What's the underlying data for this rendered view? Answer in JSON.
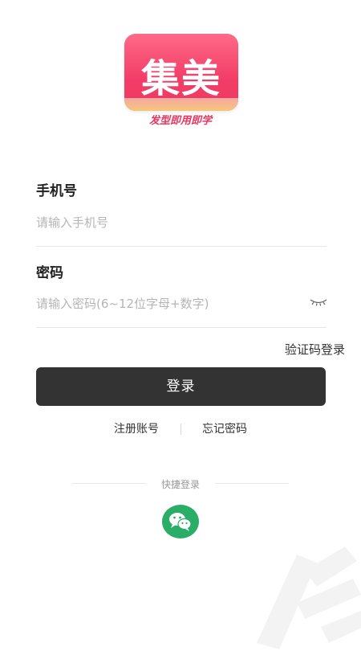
{
  "logo": {
    "text": "集美",
    "slogan": "发型即用即学"
  },
  "phone": {
    "label": "手机号",
    "placeholder": "请输入手机号",
    "value": ""
  },
  "password": {
    "label": "密码",
    "placeholder": "请输入密码(6~12位字母+数字)",
    "value": ""
  },
  "links": {
    "sms_login": "验证码登录",
    "register": "注册账号",
    "forgot": "忘记密码"
  },
  "login_button": {
    "label": "登录"
  },
  "quick_login": {
    "label": "快捷登录",
    "icon": "wechat-icon"
  },
  "colors": {
    "brand": "#f23c67",
    "button": "#333333",
    "wechat": "#2aae67"
  }
}
